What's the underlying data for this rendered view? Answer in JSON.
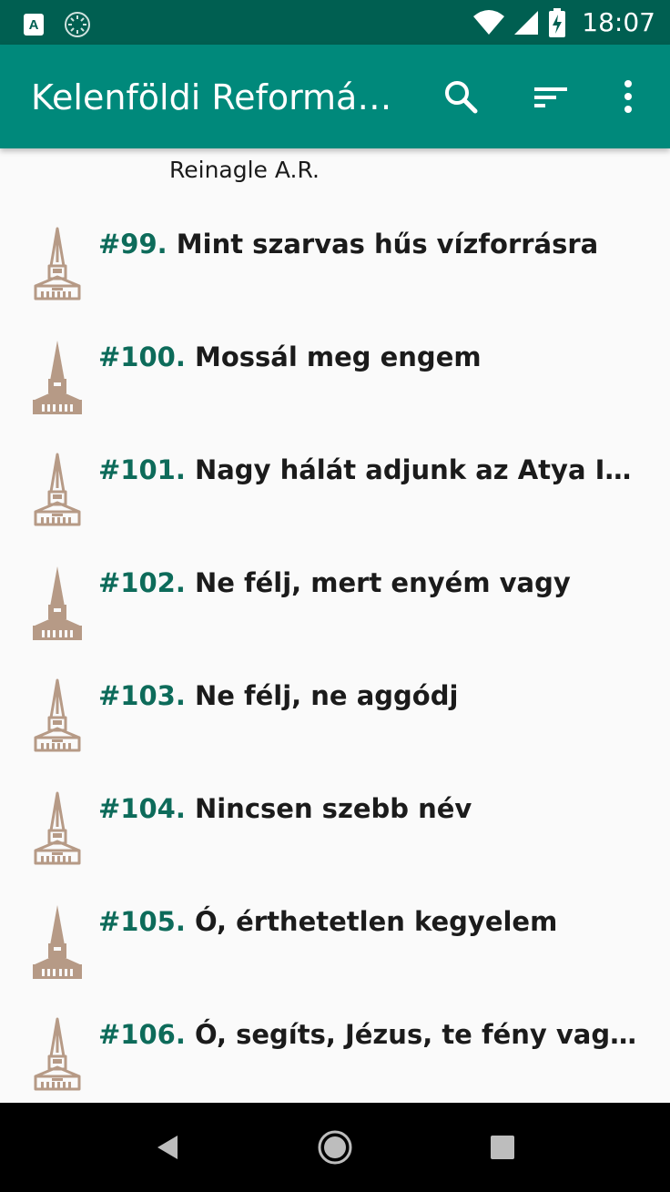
{
  "status_bar": {
    "time": "18:07",
    "notification_badge": "A",
    "icons": [
      "a-notification-icon",
      "sync-icon",
      "wifi-icon",
      "signal-icon",
      "battery-charging-icon"
    ]
  },
  "app_bar": {
    "title": "Kelenföldi Reformátusok",
    "actions": [
      "search-icon",
      "sort-icon",
      "more-vert-icon"
    ]
  },
  "colors": {
    "status_bar": "#005f51",
    "app_bar": "#00897b",
    "number_text": "#0d6b5a",
    "church_icon": "#b69a86"
  },
  "partial_row": {
    "subtitle": "Reinagle A.R."
  },
  "songs": [
    {
      "number": "#99.",
      "title": "Mint szarvas hűs vízforrásra",
      "icon_style": "outline"
    },
    {
      "number": "#100.",
      "title": "Mossál meg engem",
      "icon_style": "filled"
    },
    {
      "number": "#101.",
      "title": "Nagy hálát adjunk az Atya Istennek",
      "icon_style": "outline"
    },
    {
      "number": "#102.",
      "title": "Ne félj, mert enyém vagy",
      "icon_style": "filled"
    },
    {
      "number": "#103.",
      "title": "Ne félj, ne aggódj",
      "icon_style": "outline"
    },
    {
      "number": "#104.",
      "title": "Nincsen szebb név",
      "icon_style": "outline"
    },
    {
      "number": "#105.",
      "title": "Ó, érthetetlen kegyelem",
      "icon_style": "filled"
    },
    {
      "number": "#106.",
      "title": "Ó, segíts, Jézus, te fény vagy és élet",
      "icon_style": "outline"
    }
  ],
  "nav_bar": {
    "buttons": [
      "back-icon",
      "home-icon",
      "recents-icon"
    ]
  }
}
